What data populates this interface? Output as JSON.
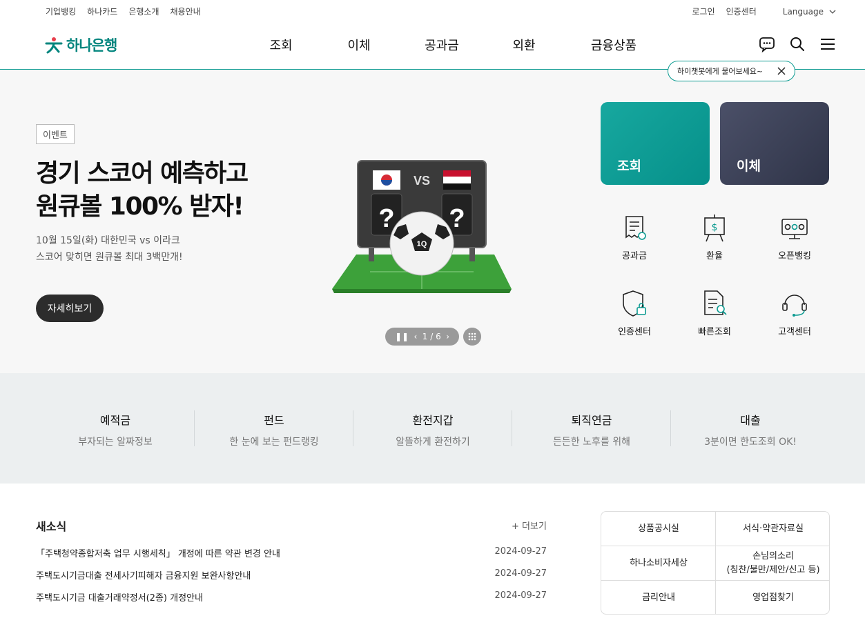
{
  "util": {
    "left": [
      "기업뱅킹",
      "하나카드",
      "은행소개",
      "채용안내"
    ],
    "login": "로그인",
    "cert": "인증센터",
    "language": "Language"
  },
  "logo": {
    "text": "하나은행"
  },
  "gnb": {
    "items": [
      "조회",
      "이체",
      "공과금",
      "외환",
      "금융상품"
    ]
  },
  "chatbot": {
    "text": "하이챗봇에게 물어보세요~"
  },
  "hero": {
    "badge": "이벤트",
    "title_line1": "경기 스코어 예측하고",
    "title_line2": "원큐볼 100% 받자!",
    "sub_line1": "10월 15일(화) 대한민국 vs 이라크",
    "sub_line2": "스코어 맞히면 원큐볼 최대 3백만개!",
    "button": "자세히보기",
    "art_vs": "VS",
    "art_q": "?",
    "art_ball": "1Q",
    "pager": "1 / 6"
  },
  "quick": {
    "big": [
      "조회",
      "이체"
    ],
    "items": [
      "공과금",
      "환율",
      "오픈뱅킹",
      "인증센터",
      "빠른조회",
      "고객센터"
    ]
  },
  "band": [
    {
      "title": "예적금",
      "sub": "부자되는 알짜정보"
    },
    {
      "title": "펀드",
      "sub": "한 눈에 보는 펀드랭킹"
    },
    {
      "title": "환전지갑",
      "sub": "알뜰하게 환전하기"
    },
    {
      "title": "퇴직연금",
      "sub": "든든한 노후를 위해"
    },
    {
      "title": "대출",
      "sub": "3분이면 한도조회 OK!"
    }
  ],
  "news": {
    "title": "새소식",
    "more": "+ 더보기",
    "items": [
      {
        "title": "「주택청약종합저축 업무 시행세칙」 개정에 따른 약관 변경 안내",
        "date": "2024-09-27"
      },
      {
        "title": "주택도시기금대출 전세사기피해자 금융지원 보완사항안내",
        "date": "2024-09-27"
      },
      {
        "title": "주택도시기금 대출거래약정서(2종) 개정안내",
        "date": "2024-09-27"
      }
    ]
  },
  "links": {
    "l1": "상품공시실",
    "l2": "서식·약관자료실",
    "l3": "하나소비자세상",
    "l4a": "손님의소리",
    "l4b": "(칭찬/불만/제안/신고 등)",
    "l5": "금리안내",
    "l6": "영업점찾기"
  },
  "colors": {
    "brand": "#00857e",
    "teal": "#0a9a90",
    "navy": "#343a50"
  }
}
